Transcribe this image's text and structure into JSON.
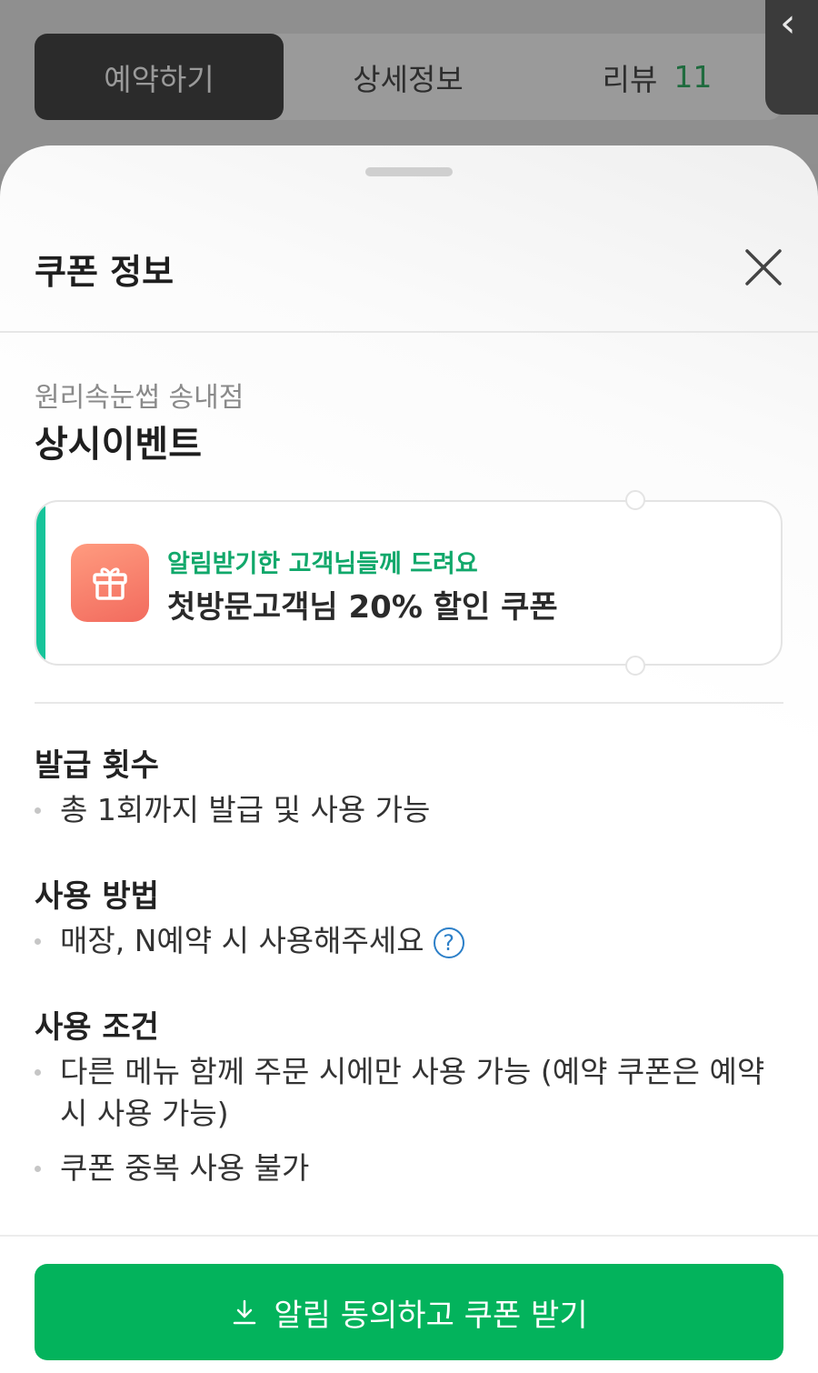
{
  "tabs": [
    {
      "label": "예약하기",
      "active": true
    },
    {
      "label": "상세정보",
      "active": false
    },
    {
      "label": "리뷰",
      "count": "11",
      "active": false
    }
  ],
  "edge_panel": {
    "icon": "chevron-left-icon",
    "glyph": "‹"
  },
  "sheet": {
    "title": "쿠폰 정보",
    "store_name": "원리속눈썹 송내점",
    "event_title": "상시이벤트"
  },
  "coupon": {
    "tag": "알림받기한 고객님들께 드려요",
    "name": "첫방문고객님 20% 할인 쿠폰",
    "accent_color": "#16c49a",
    "icon": "gift-icon"
  },
  "sections": {
    "issue": {
      "title": "발급 횟수",
      "items": [
        "총 1회까지 발급 및 사용 가능"
      ]
    },
    "usage": {
      "title": "사용 방법",
      "items": [
        "매장, N예약 시 사용해주세요"
      ]
    },
    "conditions": {
      "title": "사용 조건",
      "items": [
        "다른 메뉴 함께 주문 시에만 사용 가능 (예약 쿠폰은 예약시 사용 가능)",
        "쿠폰 중복 사용 불가"
      ]
    }
  },
  "cta": {
    "label": "알림 동의하고 쿠폰 받기",
    "icon": "download-icon",
    "color": "#03b35c"
  }
}
